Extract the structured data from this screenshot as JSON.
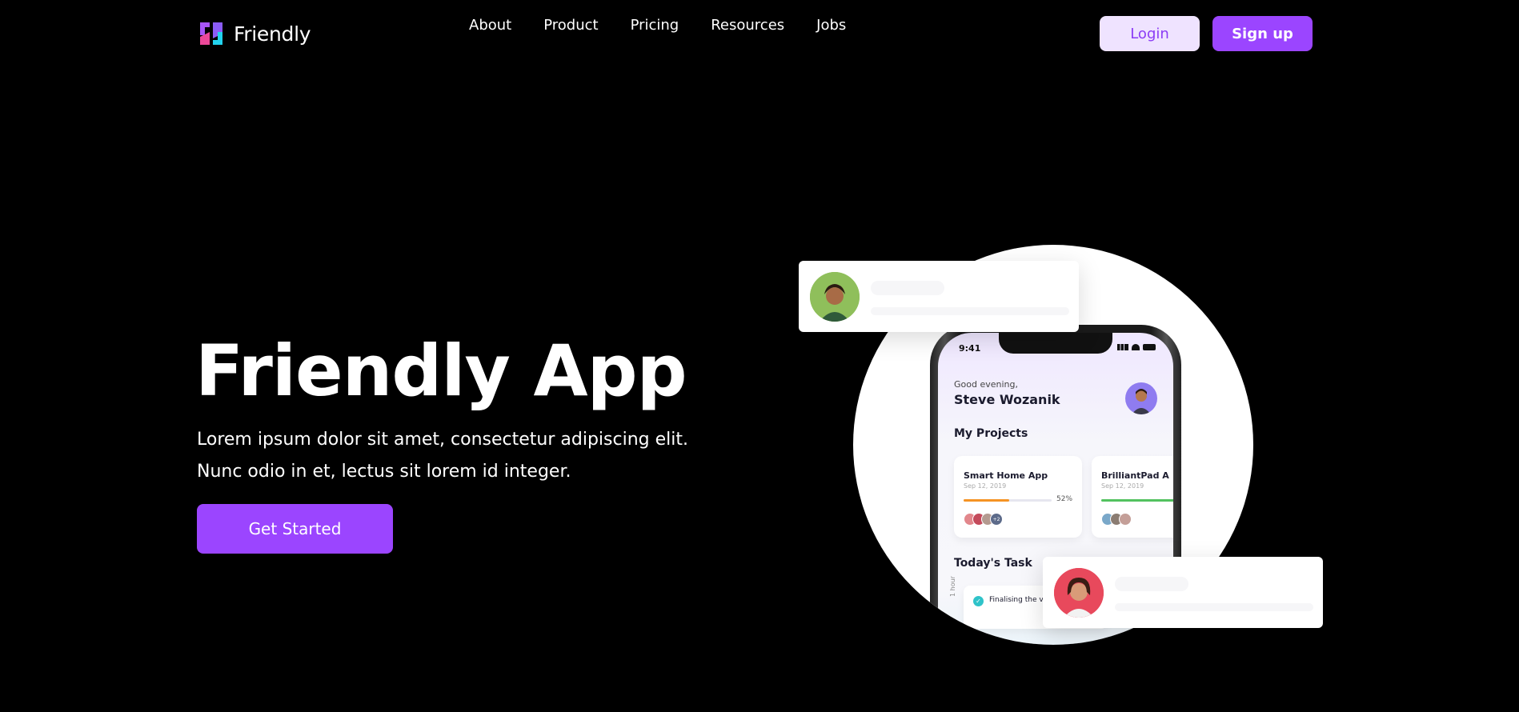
{
  "brand": {
    "name": "Friendly",
    "logo_colors": [
      "#a855f7",
      "#ec4899",
      "#22d3ee",
      "#f59e0b"
    ]
  },
  "nav": {
    "links": [
      "About",
      "Product",
      "Pricing",
      "Resources",
      "Jobs"
    ],
    "login_label": "Login",
    "signup_label": "Sign up"
  },
  "hero": {
    "title": "Friendly App",
    "description": "Lorem ipsum dolor sit amet, consectetur adipiscing elit. Nunc odio in et, lectus sit lorem id integer.",
    "cta_label": "Get Started"
  },
  "phone": {
    "status_time": "9:41",
    "greeting": "Good evening,",
    "user_name": "Steve Wozanik",
    "projects_heading": "My Projects",
    "projects": [
      {
        "title": "Smart Home App",
        "date": "Sep 12, 2019",
        "progress_pct": 52,
        "progress_label": "52%",
        "bar_color": "#f59324",
        "extra_members": "+2"
      },
      {
        "title": "BrilliantPad A",
        "date": "Sep 12, 2019",
        "progress_pct": 90,
        "bar_color": "#52c25f"
      }
    ],
    "tasks_heading": "Today's Task",
    "task_duration": "1 hour",
    "task_text": "Finalising the v for developm"
  },
  "colors": {
    "accent": "#9b45ff",
    "login_bg": "#efe3ff",
    "background": "#000000"
  }
}
